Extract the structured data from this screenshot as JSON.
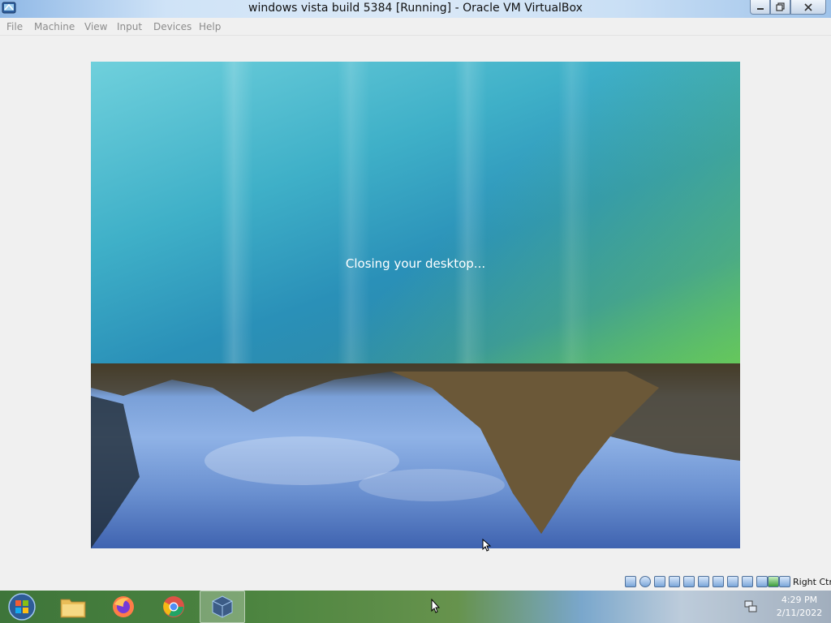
{
  "window": {
    "title": "windows vista build 5384 [Running] - Oracle VM VirtualBox"
  },
  "menu": {
    "items": [
      "File",
      "Machine",
      "View",
      "Input",
      "Devices",
      "Help"
    ]
  },
  "vm": {
    "status_text": "Closing your desktop..."
  },
  "statusbar": {
    "host_key": "Right Ctrl",
    "icons": [
      "hard-disk-icon",
      "optical-drive-icon",
      "audio-icon",
      "network-icon",
      "usb-icon",
      "shared-folders-icon",
      "display-icon",
      "video-capture-icon",
      "recording-icon",
      "cpu-icon",
      "mouse-integration-icon",
      "keyboard-icon"
    ]
  },
  "taskbar": {
    "items": [
      "start-button",
      "file-explorer",
      "firefox",
      "chrome",
      "virtualbox"
    ],
    "clock": {
      "time": "4:29 PM",
      "date": "2/11/2022"
    }
  },
  "colors": {
    "vista_teal": "#3fb0c8",
    "vista_green": "#4fae6a",
    "taskbar_green": "#3d7a30"
  }
}
